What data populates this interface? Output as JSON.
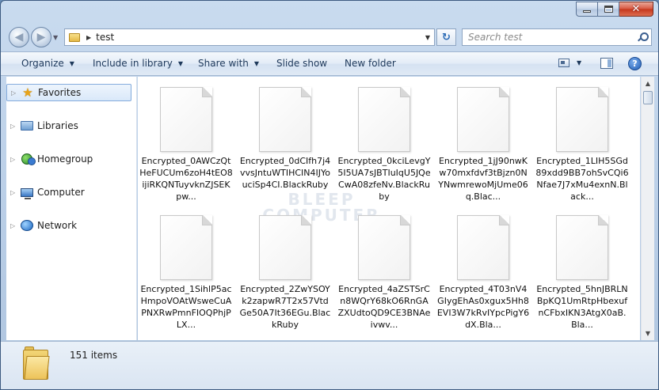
{
  "window": {
    "caption": {
      "minimize": "–",
      "maximize": "",
      "close": "✕"
    }
  },
  "address": {
    "nav_back_glyph": "◀",
    "nav_forward_glyph": "▶",
    "path": "test",
    "separator": "▶",
    "dropdown": "▼",
    "refresh_glyph": "↻",
    "search_placeholder": "Search test"
  },
  "toolbar": {
    "organize": "Organize",
    "include_in_library": "Include in library",
    "share_with": "Share with",
    "slide_show": "Slide show",
    "new_folder": "New folder",
    "dropdown_glyph": "▼",
    "help_glyph": "?"
  },
  "navigation": {
    "items": [
      {
        "label": "Favorites",
        "icon": "star-icon",
        "selected": true
      },
      {
        "label": "Libraries",
        "icon": "libraries-icon"
      },
      {
        "label": "Homegroup",
        "icon": "homegroup-icon"
      },
      {
        "label": "Computer",
        "icon": "computer-icon"
      },
      {
        "label": "Network",
        "icon": "network-icon"
      }
    ],
    "expander_glyph": "▷"
  },
  "files": [
    {
      "name": "Encrypted_0AWCzQtHeFUCUm6zoH4tEO8ijiRKQNTuyvknZJSEKpw..."
    },
    {
      "name": "Encrypted_0dCIfh7j4vvsJntuWTIHCIN4IJYouciSp4CI.BlackRuby"
    },
    {
      "name": "Encrypted_0kciLevgY5I5UA7sJBTIuIqU5JQeCwA08zfeNv.BlackRuby"
    },
    {
      "name": "Encrypted_1jJ90nwKw70mxfdvf3tBjzn0NYNwmrewoMjUme06q.Blac..."
    },
    {
      "name": "Encrypted_1LIH5SGd89xdd9BB7ohSvCQi6Nfae7J7xMu4exnN.Black..."
    },
    {
      "name": "Encrypted_1SihlP5acHmpoVOAtWsweCuAPNXRwPmnFIOQPhjPLX..."
    },
    {
      "name": "Encrypted_2ZwYSOYk2zapwR7T2x57VtdGe50A7It36EGu.BlackRuby"
    },
    {
      "name": "Encrypted_4aZSTSrCn8WQrY68kO6RnGAZXUdtoQD9CE3BNAeivwv..."
    },
    {
      "name": "Encrypted_4T03nV4GIygEhAs0xgux5Hh8EVI3W7kRvIYpcPigY6dX.Bla..."
    },
    {
      "name": "Encrypted_5hnJBRLNBpKQ1UmRtpHbexufnCFbxIKN3AtgX0aB.Bla..."
    }
  ],
  "watermark": {
    "line1": "BLEEP",
    "line2": "COMPUTER"
  },
  "scrollbar": {
    "up": "▲",
    "down": "▼"
  },
  "details": {
    "item_count": "151 items"
  }
}
